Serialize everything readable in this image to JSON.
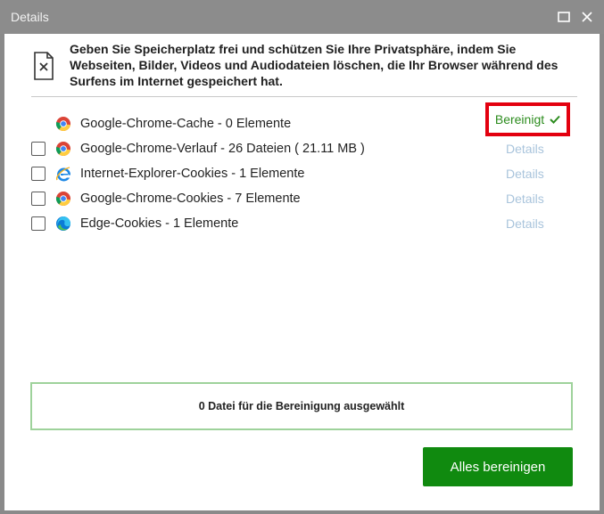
{
  "window": {
    "title": "Details"
  },
  "header": {
    "text": "Geben Sie Speicherplatz frei und schützen Sie Ihre Privatsphäre, indem Sie Webseiten, Bilder, Videos und Audiodateien löschen, die Ihr Browser während des Surfens im Internet gespeichert hat."
  },
  "items": [
    {
      "label": "Google-Chrome-Cache - 0 Elemente",
      "browser": "chrome-icon",
      "status": "Bereinigt"
    },
    {
      "label": "Google-Chrome-Verlauf - 26 Dateien ( 21.11 MB )",
      "browser": "chrome-icon",
      "action": "Details"
    },
    {
      "label": "Internet-Explorer-Cookies - 1 Elemente",
      "browser": "internet-explorer-icon",
      "action": "Details"
    },
    {
      "label": "Google-Chrome-Cookies - 7 Elemente",
      "browser": "chrome-icon",
      "action": "Details"
    },
    {
      "label": "Edge-Cookies - 1 Elemente",
      "browser": "edge-icon",
      "action": "Details"
    }
  ],
  "status": {
    "text": "0 Datei für die Bereinigung ausgewählt"
  },
  "actions": {
    "clean_all": "Alles bereinigen"
  },
  "colors": {
    "accent_green": "#108a0f",
    "cleaned_green": "#2c8c1e",
    "highlight_red": "#e3000f",
    "details_link": "#a9c4dc"
  }
}
